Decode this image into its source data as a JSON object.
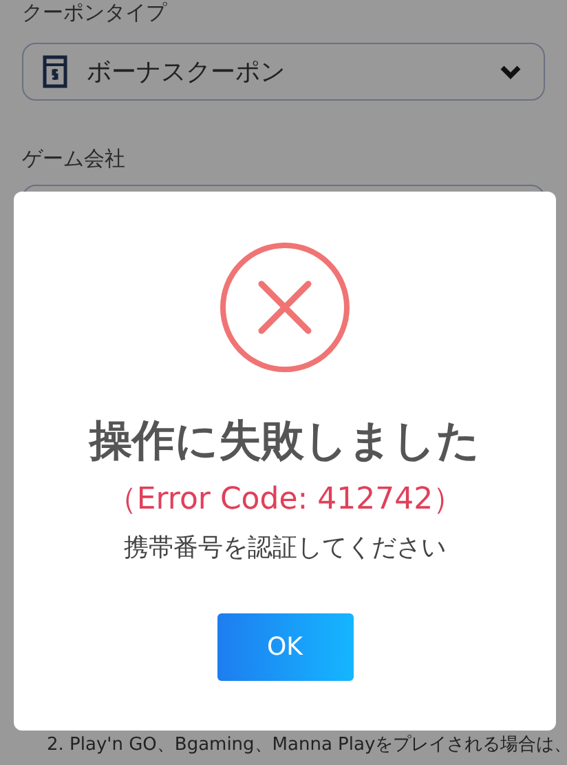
{
  "form": {
    "coupon_type_label": "クーポンタイプ",
    "coupon_type_value": "ボーナスクーポン",
    "game_company_label": "ゲーム会社"
  },
  "dialog": {
    "title": "操作に失敗しました",
    "error_code": "（Error Code: 412742）",
    "message": "携帯番号を認証してください",
    "button": "OK"
  },
  "note": "2. Play'n GO、Bgaming、Manna Playをプレイされる場合は、"
}
